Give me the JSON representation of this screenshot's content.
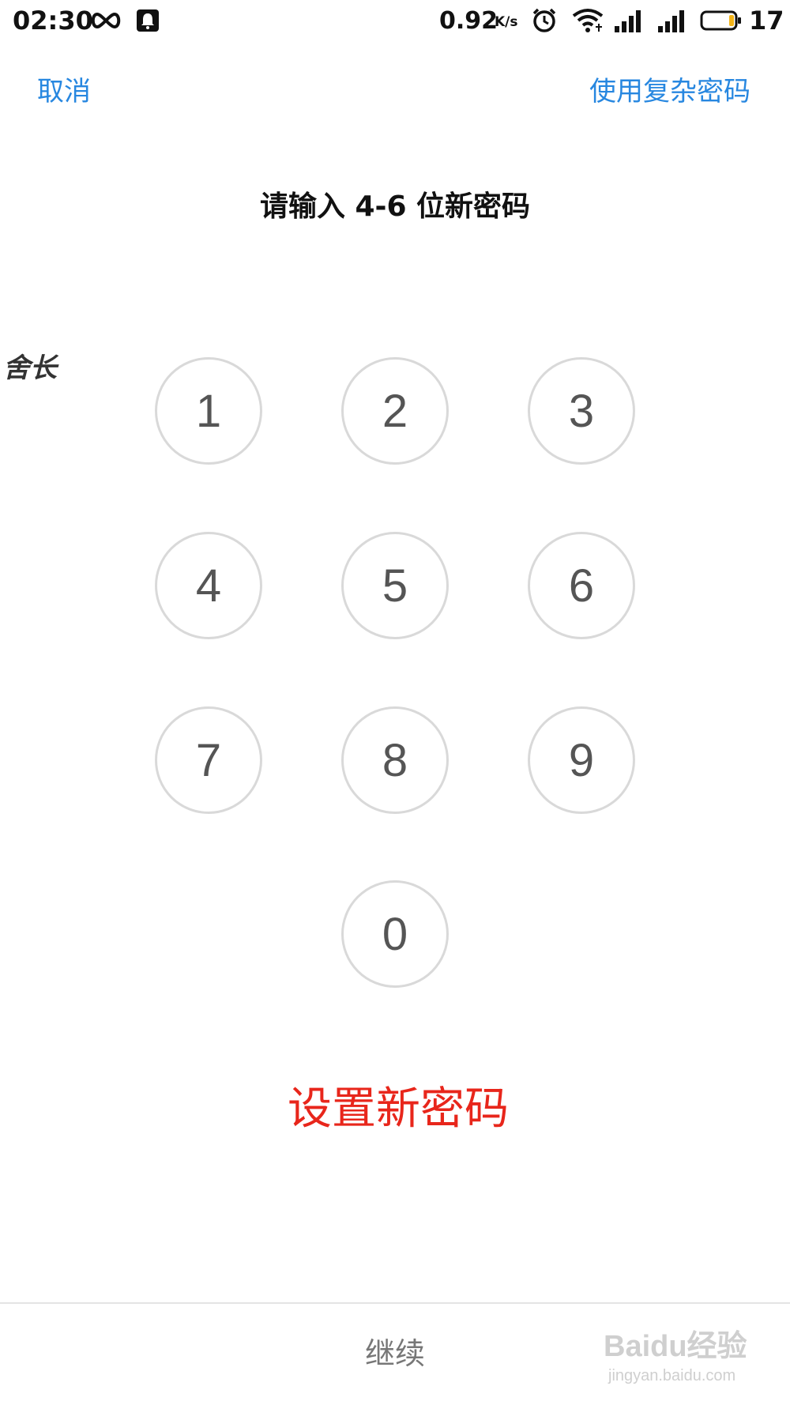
{
  "status_bar": {
    "time": "02:30",
    "net_speed": "0.92",
    "net_speed_unit": "K/s",
    "battery_level": "17",
    "icons": [
      "infinity-icon",
      "notification-bell-icon",
      "alarm-icon",
      "wifi-icon",
      "signal-icon",
      "signal-icon",
      "battery-icon"
    ]
  },
  "header": {
    "cancel_label": "取消",
    "complex_password_label": "使用复杂密码"
  },
  "prompt": "请输入 4-6 位新密码",
  "watermark_left": "舍长",
  "keypad": {
    "keys": [
      "1",
      "2",
      "3",
      "4",
      "5",
      "6",
      "7",
      "8",
      "9",
      "0"
    ]
  },
  "caption": "设置新密码",
  "footer": {
    "continue_label": "继续"
  },
  "brand_watermark": {
    "text": "Baidu经验",
    "url": "jingyan.baidu.com"
  },
  "colors": {
    "accent_blue": "#2787e0",
    "caption_red": "#e8261b",
    "key_border": "#d9d9d9"
  }
}
